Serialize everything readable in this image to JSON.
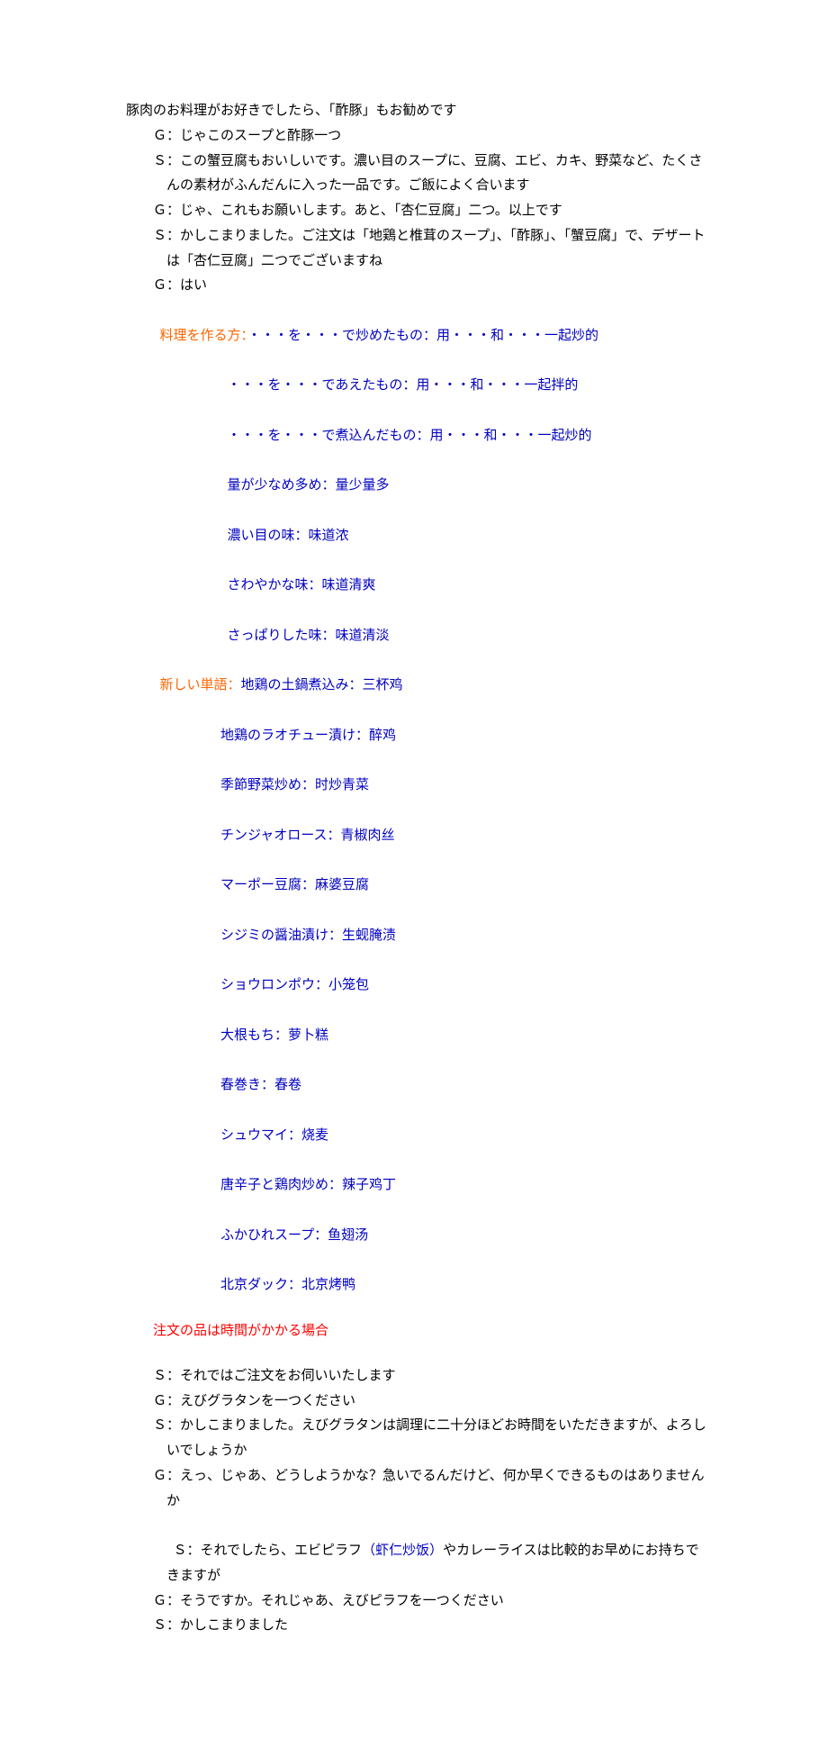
{
  "dialog1": [
    "豚肉のお料理がお好きでしたら、「酢豚」もお勧めです",
    "Ｇ：じゃこのスープと酢豚一つ",
    "Ｓ：この蟹豆腐もおいしいです。濃い目のスープに、豆腐、エビ、カキ、野菜など、たくさんの素材がふんだんに入った一品です。ご飯によく合います",
    "Ｇ：じゃ、これもお願いします。あと、「杏仁豆腐」二つ。以上です",
    "Ｓ：かしこまりました。ご注文は「地鶏と椎茸のスープ」、「酢豚」、「蟹豆腐」で、デザートは「杏仁豆腐」二つでございますね",
    "Ｇ：はい"
  ],
  "cooking": {
    "label": "料理を作る方：",
    "lines": [
      {
        "jp": "・・・を・・・で炒めたもの：",
        "cn": "用・・・和・・・一起炒的"
      },
      {
        "jp": "・・・を・・・であえたもの：",
        "cn": "用・・・和・・・一起拌的"
      },
      {
        "jp": "・・・を・・・で煮込んだもの：",
        "cn": "用・・・和・・・一起炒的"
      },
      {
        "jp": "量が少なめ多め：",
        "cn": "量少量多"
      },
      {
        "jp": "濃い目の味：",
        "cn": "味道浓"
      },
      {
        "jp": "さわやかな味：",
        "cn": "味道清爽"
      },
      {
        "jp": "さっぱりした味：",
        "cn": "味道清淡"
      }
    ]
  },
  "vocab": {
    "label": "新しい単語：",
    "items": [
      {
        "jp": "地鶏の土鍋煮込み：",
        "cn": "三杯鸡"
      },
      {
        "jp": "地鶏のラオチュー漬け：",
        "cn": "醉鸡"
      },
      {
        "jp": "季節野菜炒め：",
        "cn": "时炒青菜"
      },
      {
        "jp": "チンジャオロース：",
        "cn": "青椒肉丝"
      },
      {
        "jp": "マーポー豆腐：",
        "cn": "麻婆豆腐"
      },
      {
        "jp": "シジミの醤油漬け：",
        "cn": "生蚬腌渍"
      },
      {
        "jp": "ショウロンポウ：",
        "cn": "小笼包"
      },
      {
        "jp": "大根もち：",
        "cn": "萝卜糕"
      },
      {
        "jp": "春巻き：",
        "cn": "春卷"
      },
      {
        "jp": "シュウマイ：",
        "cn": "烧麦"
      },
      {
        "jp": "唐辛子と鶏肉炒め：",
        "cn": "辣子鸡丁"
      },
      {
        "jp": "ふかひれスープ：",
        "cn": "鱼翅汤"
      },
      {
        "jp": "北京ダック：",
        "cn": "北京烤鸭"
      }
    ]
  },
  "section2_title": "注文の品は時間がかかる場合",
  "dialog2": [
    {
      "text": "Ｓ：それではご注文をお伺いいたします"
    },
    {
      "text": "Ｇ：えびグラタンを一つください"
    },
    {
      "text": "Ｓ：かしこまりました。えびグラタンは調理に二十分ほどお時間をいただきますが、よろしいでしょうか"
    },
    {
      "text": "Ｇ：えっ、じゃあ、どうしようかな？急いでるんだけど、何か早くできるものはありませんか"
    },
    {
      "pre": "Ｓ：それでしたら、エビピラフ",
      "paren": "（虾仁炒饭）",
      "post": "やカレーライスは比較的お早めにお持ちできますが"
    },
    {
      "text": "Ｇ：そうですか。それじゃあ、えびピラフを一つください"
    },
    {
      "text": "Ｓ：かしこまりました"
    }
  ]
}
